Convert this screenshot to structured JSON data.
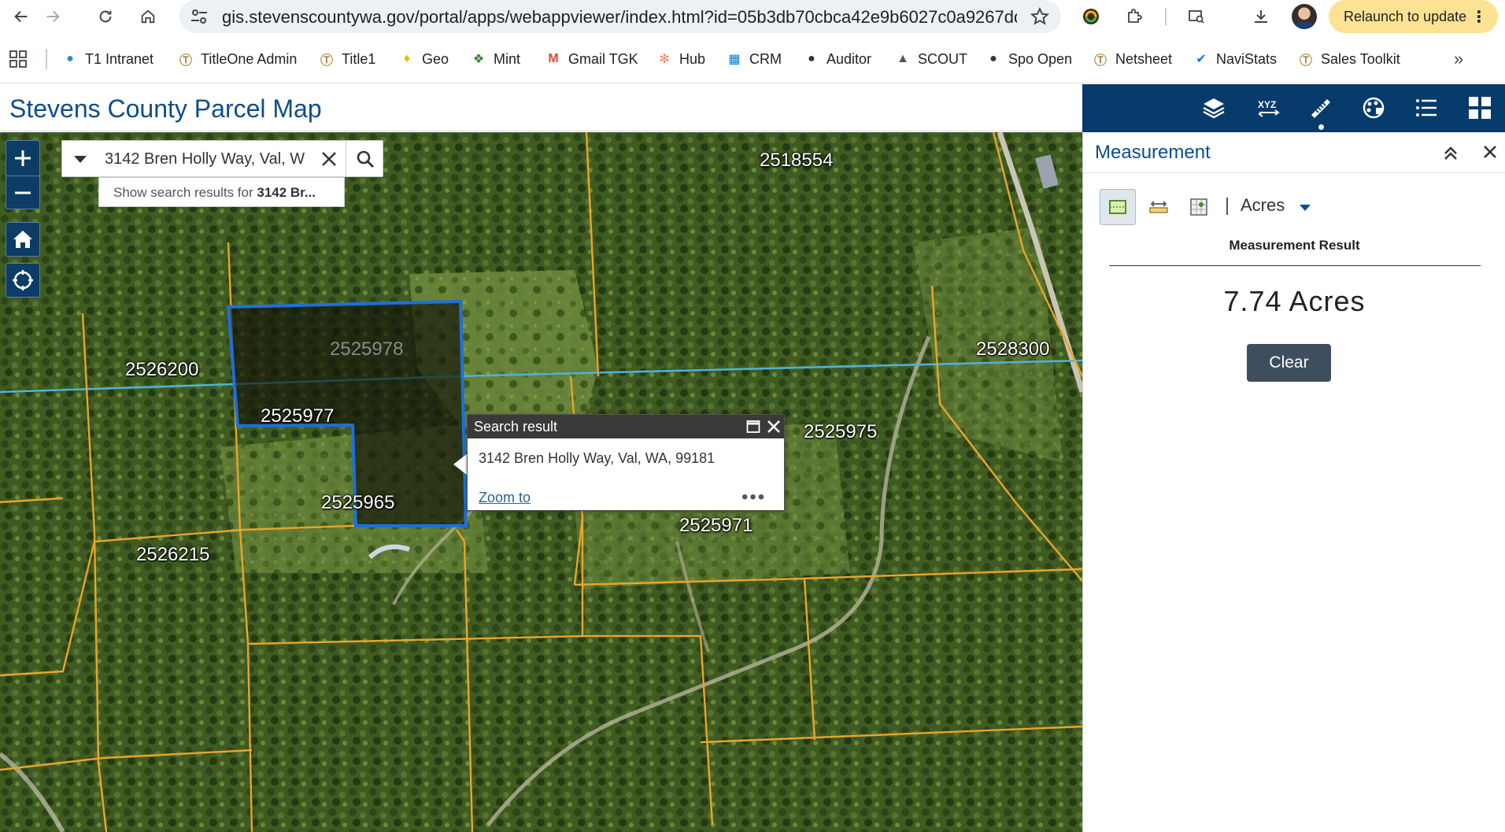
{
  "browser": {
    "url": "gis.stevenscountywa.gov/portal/apps/webappviewer/index.html?id=05b3db70cbca42e9b6027c0a9267dd...",
    "relaunch_label": "Relaunch to update",
    "bookmarks": [
      {
        "label": "T1 Intranet",
        "icon": "globe-icon",
        "color": "#2a8fbd"
      },
      {
        "label": "TitleOne Admin",
        "icon": "titleone-icon",
        "color": "#b08a4a"
      },
      {
        "label": "Title1",
        "icon": "titleone-icon",
        "color": "#b08a4a"
      },
      {
        "label": "Geo",
        "icon": "map-pin-icon",
        "color": "#f4b400"
      },
      {
        "label": "Mint",
        "icon": "mint-icon",
        "color": "#2e7d32"
      },
      {
        "label": "Gmail TGK",
        "icon": "gmail-icon",
        "color": "#ea4335"
      },
      {
        "label": "Hub",
        "icon": "hubspot-icon",
        "color": "#ff7a59"
      },
      {
        "label": "CRM",
        "icon": "microsoft-icon",
        "color": "#0078d4"
      },
      {
        "label": "Auditor",
        "icon": "globe-icon",
        "color": "#333333"
      },
      {
        "label": "SCOUT",
        "icon": "scout-icon",
        "color": "#555555"
      },
      {
        "label": "Spo Open",
        "icon": "globe-icon",
        "color": "#333333"
      },
      {
        "label": "Netsheet",
        "icon": "titleone-icon",
        "color": "#b08a4a"
      },
      {
        "label": "NaviStats",
        "icon": "navistats-icon",
        "color": "#1a73e8"
      },
      {
        "label": "Sales Toolkit",
        "icon": "titleone-icon",
        "color": "#b08a4a"
      }
    ]
  },
  "app": {
    "title": "Stevens County Parcel Map",
    "toolbar_icons": [
      "layers-icon",
      "coordinate-icon",
      "measure-icon",
      "basemap-icon",
      "legend-icon",
      "apps-grid-icon"
    ]
  },
  "map": {
    "search": {
      "value": "3142 Bren Holly Way, Val, W",
      "suggestion_prefix": "Show search results for ",
      "suggestion_term": "3142 Br..."
    },
    "popup": {
      "title": "Search result",
      "address": "3142 Bren Holly Way, Val, WA, 99181",
      "zoom_label": "Zoom to",
      "more_label": "•••"
    },
    "parcels": [
      {
        "id": "2518554"
      },
      {
        "id": "2525978"
      },
      {
        "id": "2526200"
      },
      {
        "id": "2525977"
      },
      {
        "id": "2525975"
      },
      {
        "id": "2528300"
      },
      {
        "id": "2525965"
      },
      {
        "id": "2525971"
      },
      {
        "id": "2526215"
      }
    ],
    "colors": {
      "parcel_line": "#e8a52a",
      "selected_outline": "#1e6fd9",
      "water_line": "#4fb3d9"
    }
  },
  "panel": {
    "title": "Measurement",
    "unit": "Acres",
    "result_label": "Measurement Result",
    "result_value": "7.74 Acres",
    "clear_label": "Clear"
  }
}
